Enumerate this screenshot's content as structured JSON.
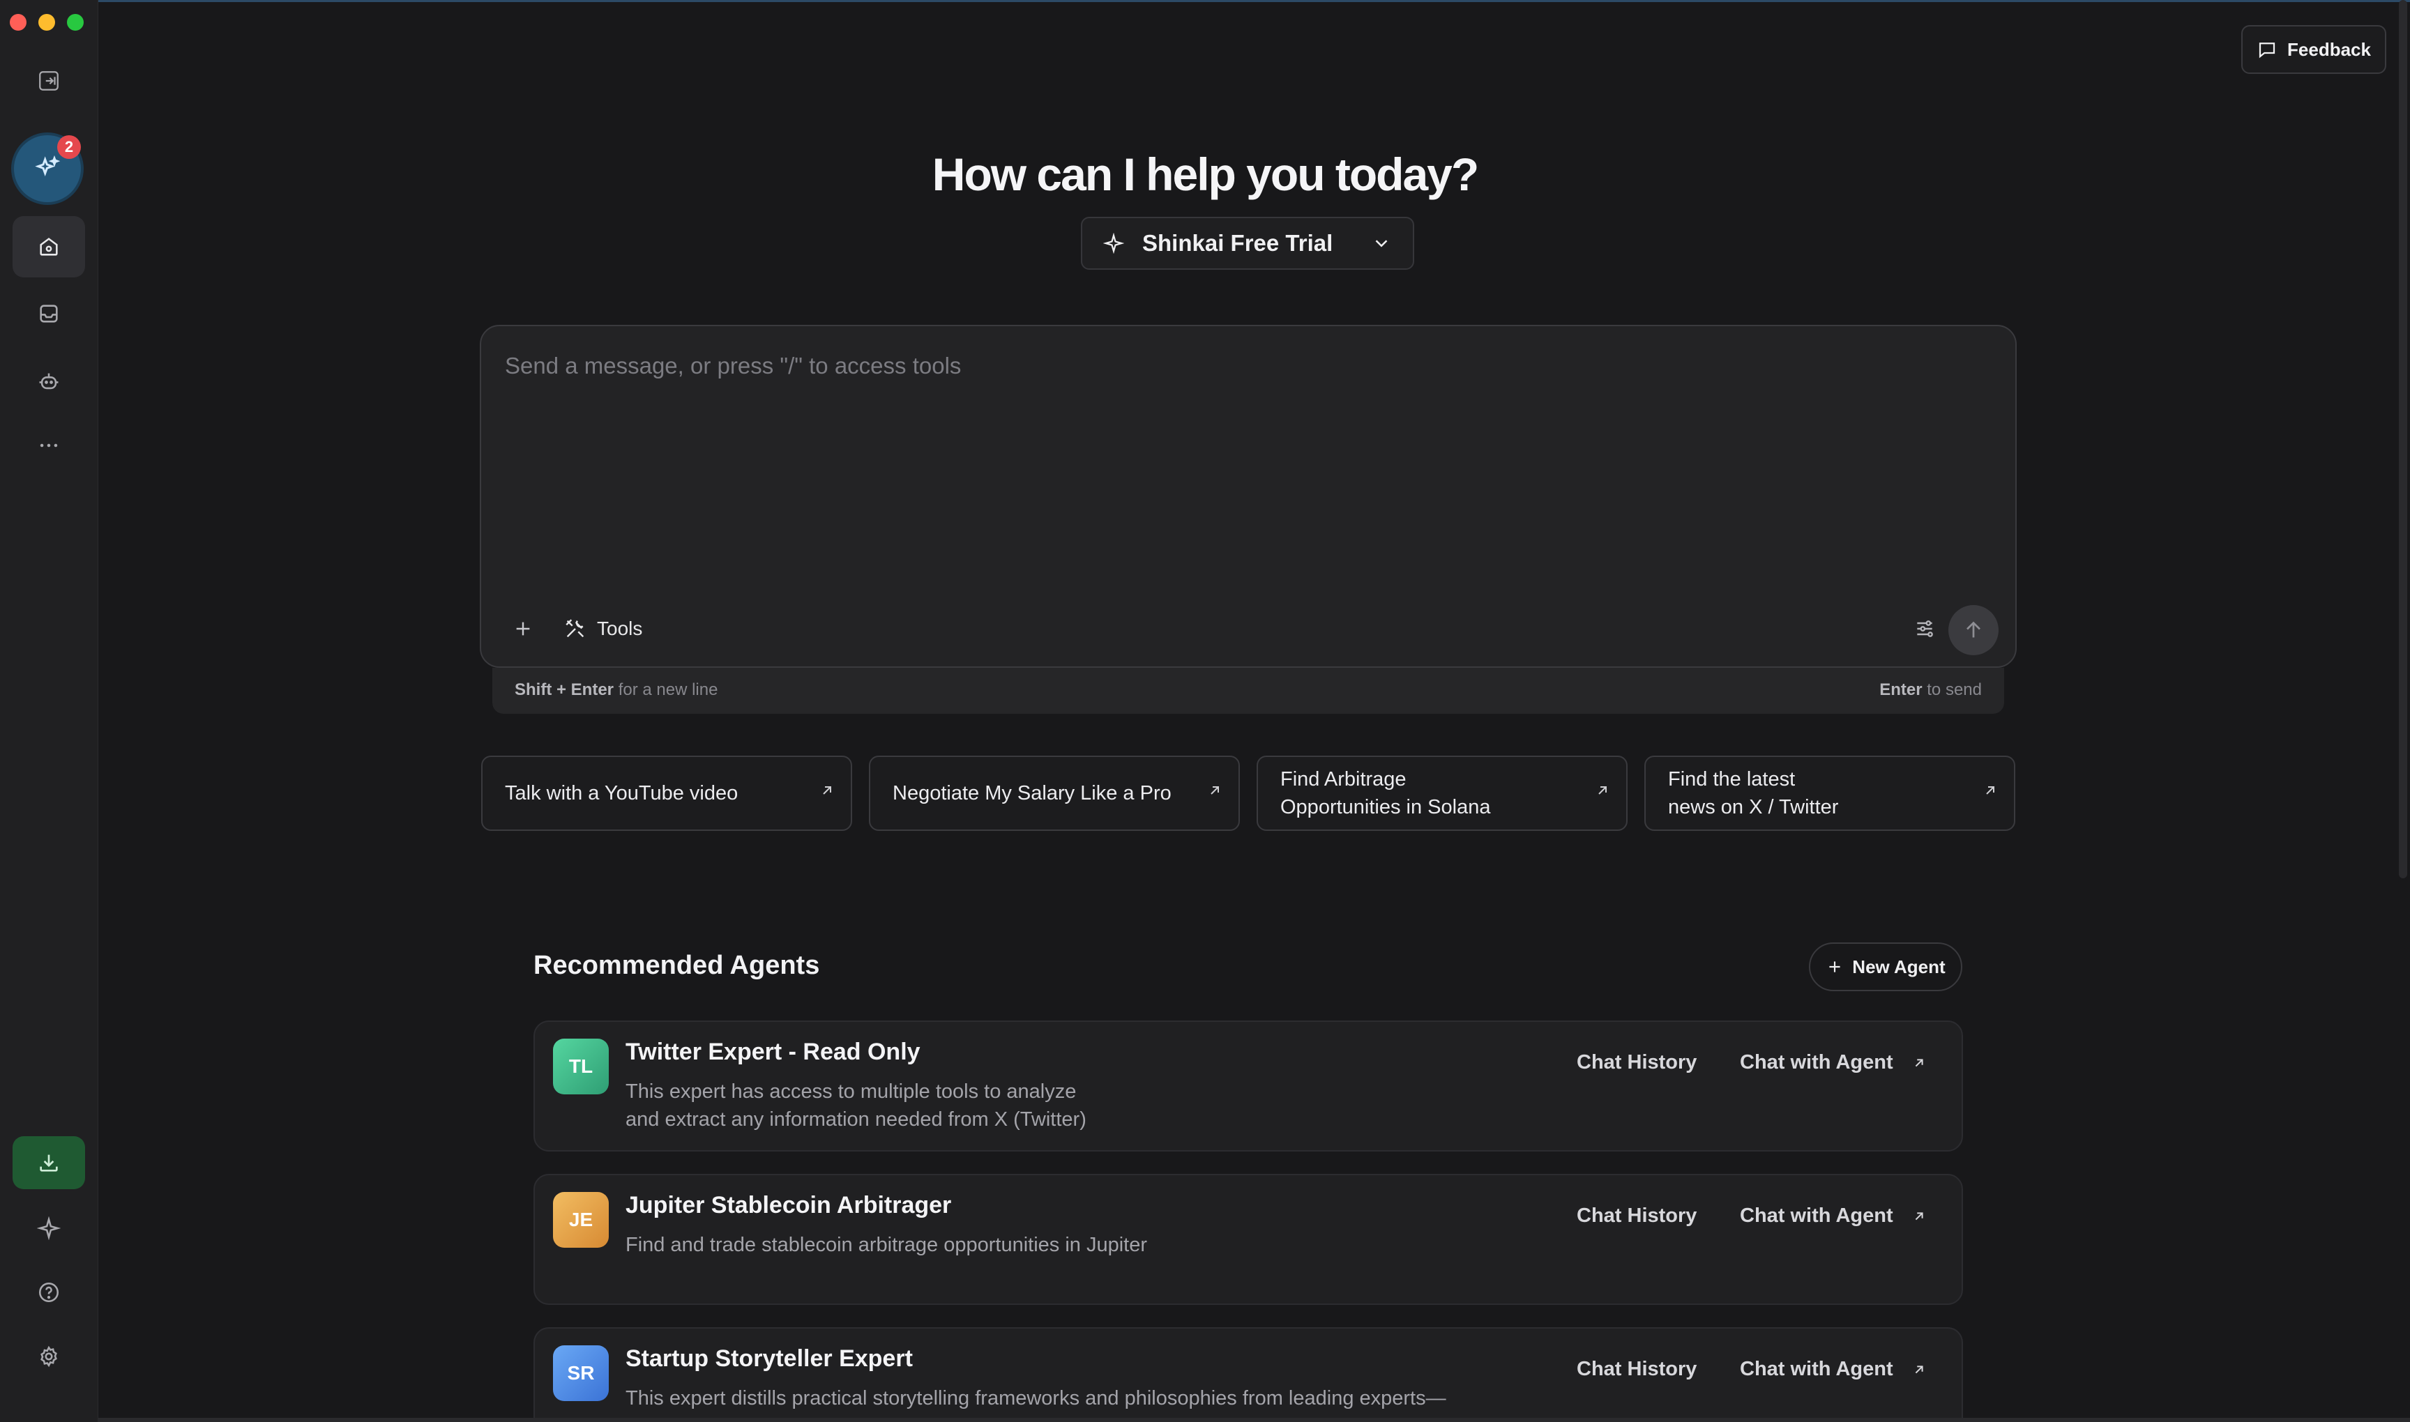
{
  "window": {
    "traffic_lights": [
      "#ff5f57",
      "#febc2e",
      "#28c840"
    ]
  },
  "sidebar": {
    "notification_count": "2",
    "items": [
      {
        "icon": "collapse-sidebar-icon"
      },
      {
        "icon": "home-icon",
        "active": true
      },
      {
        "icon": "inbox-icon"
      },
      {
        "icon": "robot-icon"
      },
      {
        "icon": "more-horizontal-icon"
      },
      {
        "icon": "download-icon"
      },
      {
        "icon": "sparkle-icon"
      },
      {
        "icon": "help-icon"
      },
      {
        "icon": "gear-icon"
      }
    ]
  },
  "header": {
    "feedback_label": "Feedback"
  },
  "hero": {
    "title": "How can I help you today?"
  },
  "model_selector": {
    "selected": "Shinkai Free Trial"
  },
  "composer": {
    "placeholder": "Send a message, or press \"/\" to access tools",
    "tools_label": "Tools",
    "hint_left_key": "Shift + Enter",
    "hint_left_text": "for a new line",
    "hint_right_key": "Enter",
    "hint_right_text": "to send"
  },
  "suggestions": [
    {
      "line1": "Talk with a YouTube video",
      "line2": ""
    },
    {
      "line1": "Negotiate My Salary Like a Pro",
      "line2": ""
    },
    {
      "line1": "Find Arbitrage",
      "line2": "Opportunities in Solana"
    },
    {
      "line1": "Find the latest",
      "line2": "news on X / Twitter"
    }
  ],
  "agents_section": {
    "title": "Recommended Agents",
    "new_agent_label": "New Agent",
    "chat_history_label": "Chat History",
    "chat_with_agent_label": "Chat with Agent",
    "agents": [
      {
        "initials": "TL",
        "name": "Twitter Expert - Read Only",
        "desc1": "This expert has access to multiple tools to analyze",
        "desc2": "and extract any information needed from X (Twitter)",
        "color": "#3fbf8a"
      },
      {
        "initials": "JE",
        "name": "Jupiter Stablecoin Arbitrager",
        "desc1": "Find and trade stablecoin arbitrage opportunities in Jupiter",
        "desc2": "",
        "color": "#e2a04a"
      },
      {
        "initials": "SR",
        "name": "Startup Storyteller Expert",
        "desc1": "This expert distills practical storytelling frameworks and philosophies from leading experts—",
        "desc2": "",
        "color": "#4f8fe8"
      }
    ]
  }
}
